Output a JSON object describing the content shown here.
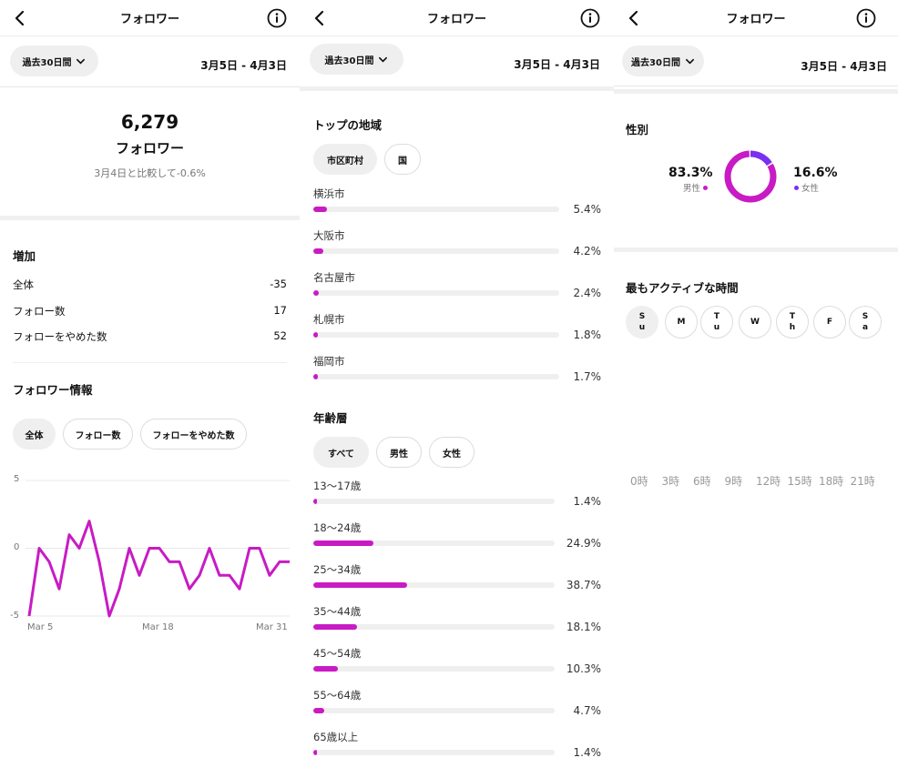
{
  "header": {
    "title": "フォロワー",
    "range_button": "過去30日間",
    "date_range": "3月5日 - 4月3日"
  },
  "overview": {
    "total": "6,279",
    "label": "フォロワー",
    "comparison": "3月4日と比較して-0.6%",
    "growth_title": "増加",
    "rows": [
      {
        "label": "全体",
        "value": "-35"
      },
      {
        "label": "フォロー数",
        "value": "17"
      },
      {
        "label": "フォローをやめた数",
        "value": "52"
      }
    ],
    "info_title": "フォロワー情報",
    "chips": [
      "全体",
      "フォロー数",
      "フォローをやめた数"
    ],
    "accent": "#c81bc4"
  },
  "chart_data": {
    "type": "line",
    "title": "",
    "xlabel": "",
    "ylabel": "",
    "ylim": [
      -5,
      5
    ],
    "yticks": [
      "5",
      "0",
      "-5"
    ],
    "xticks": [
      "Mar 5",
      "Mar 18",
      "Mar 31"
    ],
    "grid": true,
    "series": [
      {
        "values": [
          -5,
          0,
          -1,
          -3,
          1,
          0,
          2,
          -1,
          -5,
          -3,
          0,
          -2,
          0,
          0,
          -1,
          -1,
          -3,
          -2,
          0,
          -2,
          -2,
          -3,
          0,
          0,
          -2,
          -1,
          -1
        ]
      }
    ]
  },
  "regions": {
    "title": "トップの地域",
    "chips": [
      "市区町村",
      "国"
    ],
    "items": [
      {
        "name": "横浜市",
        "pct": "5.4%",
        "value": 5.4
      },
      {
        "name": "大阪市",
        "pct": "4.2%",
        "value": 4.2
      },
      {
        "name": "名古屋市",
        "pct": "2.4%",
        "value": 2.4
      },
      {
        "name": "札幌市",
        "pct": "1.8%",
        "value": 1.8
      },
      {
        "name": "福岡市",
        "pct": "1.7%",
        "value": 1.7
      }
    ]
  },
  "ages": {
    "title": "年齢層",
    "chips": [
      "すべて",
      "男性",
      "女性"
    ],
    "items": [
      {
        "name": "13〜17歳",
        "pct": "1.4%",
        "value": 1.4
      },
      {
        "name": "18〜24歳",
        "pct": "24.9%",
        "value": 24.9
      },
      {
        "name": "25〜34歳",
        "pct": "38.7%",
        "value": 38.7
      },
      {
        "name": "35〜44歳",
        "pct": "18.1%",
        "value": 18.1
      },
      {
        "name": "45〜54歳",
        "pct": "10.3%",
        "value": 10.3
      },
      {
        "name": "55〜64歳",
        "pct": "4.7%",
        "value": 4.7
      },
      {
        "name": "65歳以上",
        "pct": "1.4%",
        "value": 1.4
      }
    ]
  },
  "gender": {
    "title": "性別",
    "male": {
      "pct": "83.3%",
      "label": "男性",
      "value": 83.3,
      "color": "#c81bc4"
    },
    "female": {
      "pct": "16.6%",
      "label": "女性",
      "value": 16.6,
      "color": "#7b2ff2"
    }
  },
  "active": {
    "title": "最もアクティブな時間",
    "days": [
      {
        "l1": "S",
        "l2": "u"
      },
      {
        "l1": "M",
        "l2": ""
      },
      {
        "l1": "T",
        "l2": "u"
      },
      {
        "l1": "W",
        "l2": ""
      },
      {
        "l1": "T",
        "l2": "h"
      },
      {
        "l1": "F",
        "l2": ""
      },
      {
        "l1": "S",
        "l2": "a"
      }
    ],
    "hours": [
      "0時",
      "3時",
      "6時",
      "9時",
      "12時",
      "15時",
      "18時",
      "21時"
    ]
  },
  "icons": {
    "back": "chevron-left-icon",
    "info": "info-icon",
    "dropdown": "chevron-down-icon"
  }
}
